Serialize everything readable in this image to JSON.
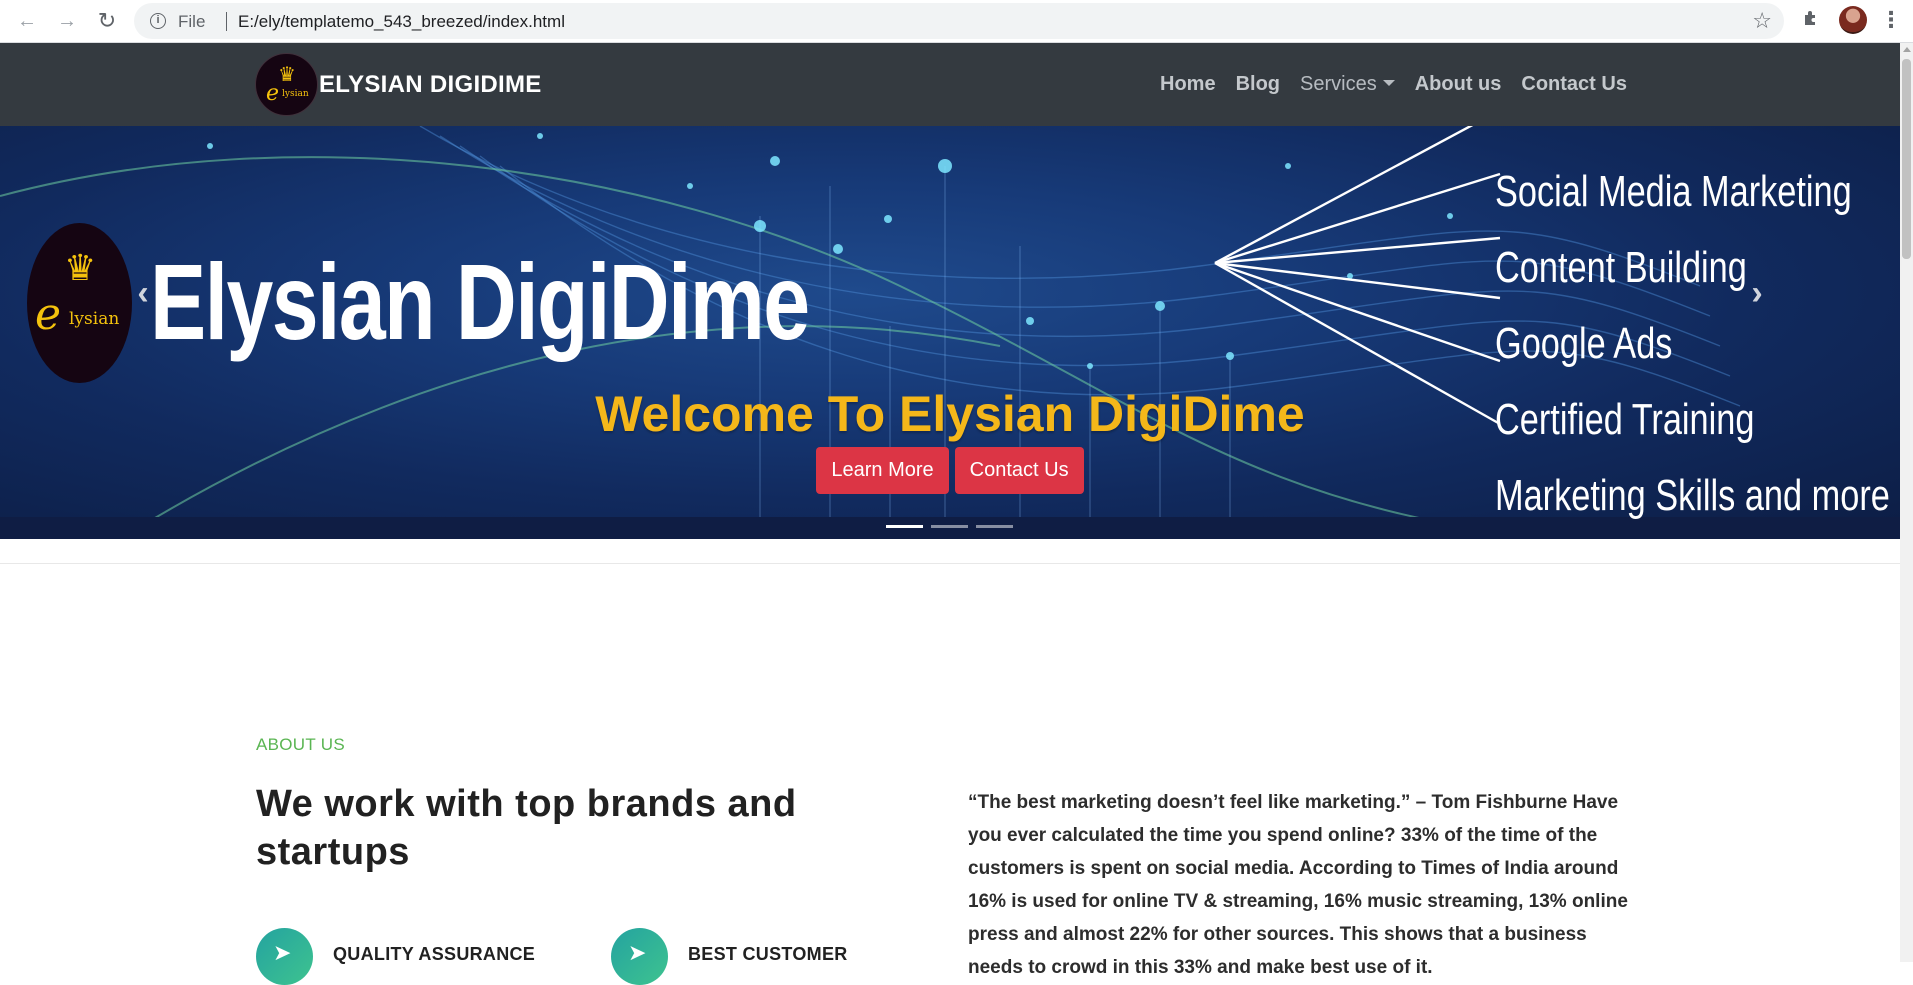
{
  "browser": {
    "back_icon": "arrow-left-icon",
    "forward_icon": "arrow-right-icon",
    "reload_icon": "reload-icon",
    "info_icon": "info-icon",
    "scheme_label": "File",
    "url": "E:/ely/templatemo_543_breezed/index.html",
    "bookmark_icon": "star-icon",
    "extensions_icon": "puzzle-icon",
    "menu_icon": "kebab-menu-icon"
  },
  "navbar": {
    "brand": "ELYSIAN DIGIDIME",
    "logo_letter": "e",
    "logo_word": "lysian",
    "links": [
      {
        "label": "Home"
      },
      {
        "label": "Blog"
      },
      {
        "label": "Services"
      },
      {
        "label": "About us"
      },
      {
        "label": "Contact Us"
      }
    ]
  },
  "hero": {
    "banner_title": "Elysian DigiDime",
    "logo_letter": "e",
    "logo_word": "lysian",
    "services": [
      "Social Media Marketing",
      "Content Building",
      "Google Ads",
      "Certified Training",
      "Marketing Skills and more"
    ],
    "caption": "Welcome To Elysian DigiDime",
    "buttons": {
      "learn_more": "Learn More",
      "contact_us": "Contact Us"
    },
    "active_slide": 1,
    "slide_count": 3
  },
  "about": {
    "eyebrow": "ABOUT US",
    "title": "We work with top brands and startups",
    "text": "“The best marketing doesn’t feel like marketing.” – Tom Fishburne Have you ever calculated the time you spend online? 33% of the time of the customers is spent on social media. According to Times of India around 16% is used for online TV & streaming, 16% music streaming, 13% online press and almost 22% for other sources. This shows that a business needs to crowd in this 33% and make best use of it.",
    "features": [
      {
        "label": "QUALITY ASSURANCE",
        "icon": "rocket-icon"
      },
      {
        "label": "BEST CUSTOMER",
        "icon": "rocket-icon"
      }
    ]
  },
  "colors": {
    "navbar_bg": "#343a40",
    "accent_green": "#5ab552",
    "caption_yellow": "#f4b71a",
    "button_red": "#dc3545"
  }
}
